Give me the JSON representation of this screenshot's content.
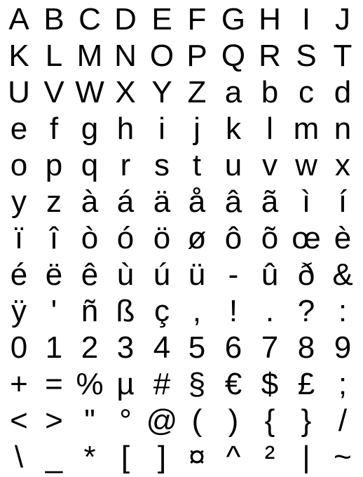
{
  "glyph_rows": [
    [
      "A",
      "B",
      "C",
      "D",
      "E",
      "F",
      "G",
      "H",
      "I",
      "J"
    ],
    [
      "K",
      "L",
      "M",
      "N",
      "O",
      "P",
      "Q",
      "R",
      "S",
      "T"
    ],
    [
      "U",
      "V",
      "W",
      "X",
      "Y",
      "Z",
      "a",
      "b",
      "c",
      "d"
    ],
    [
      "e",
      "f",
      "g",
      "h",
      "i",
      "j",
      "k",
      "l",
      "m",
      "n"
    ],
    [
      "o",
      "p",
      "q",
      "r",
      "s",
      "t",
      "u",
      "v",
      "w",
      "x"
    ],
    [
      "y",
      "z",
      "à",
      "á",
      "ä",
      "å",
      "â",
      "ã",
      "ì",
      "í"
    ],
    [
      "ï",
      "î",
      "ò",
      "ó",
      "ö",
      "ø",
      "ô",
      "õ",
      "œ",
      "è"
    ],
    [
      "é",
      "ë",
      "ê",
      "ù",
      "ú",
      "ü",
      "-",
      "û",
      "ð",
      "&"
    ],
    [
      "ÿ",
      "'",
      "ñ",
      "ß",
      "ç",
      ",",
      "!",
      ".",
      "?",
      ":"
    ],
    [
      "0",
      "1",
      "2",
      "3",
      "4",
      "5",
      "6",
      "7",
      "8",
      "9"
    ],
    [
      "+",
      "=",
      "%",
      "µ",
      "#",
      "§",
      "€",
      "$",
      "£",
      ";"
    ],
    [
      "<",
      ">",
      "\"",
      "°",
      "@",
      "(",
      ")",
      "{",
      "}",
      "/"
    ],
    [
      "\\",
      "_",
      "*",
      "[",
      "]",
      "¤",
      "^",
      "²",
      "|",
      "~"
    ]
  ],
  "colors": {
    "background": "#ffffff",
    "glyph": "#000000"
  }
}
